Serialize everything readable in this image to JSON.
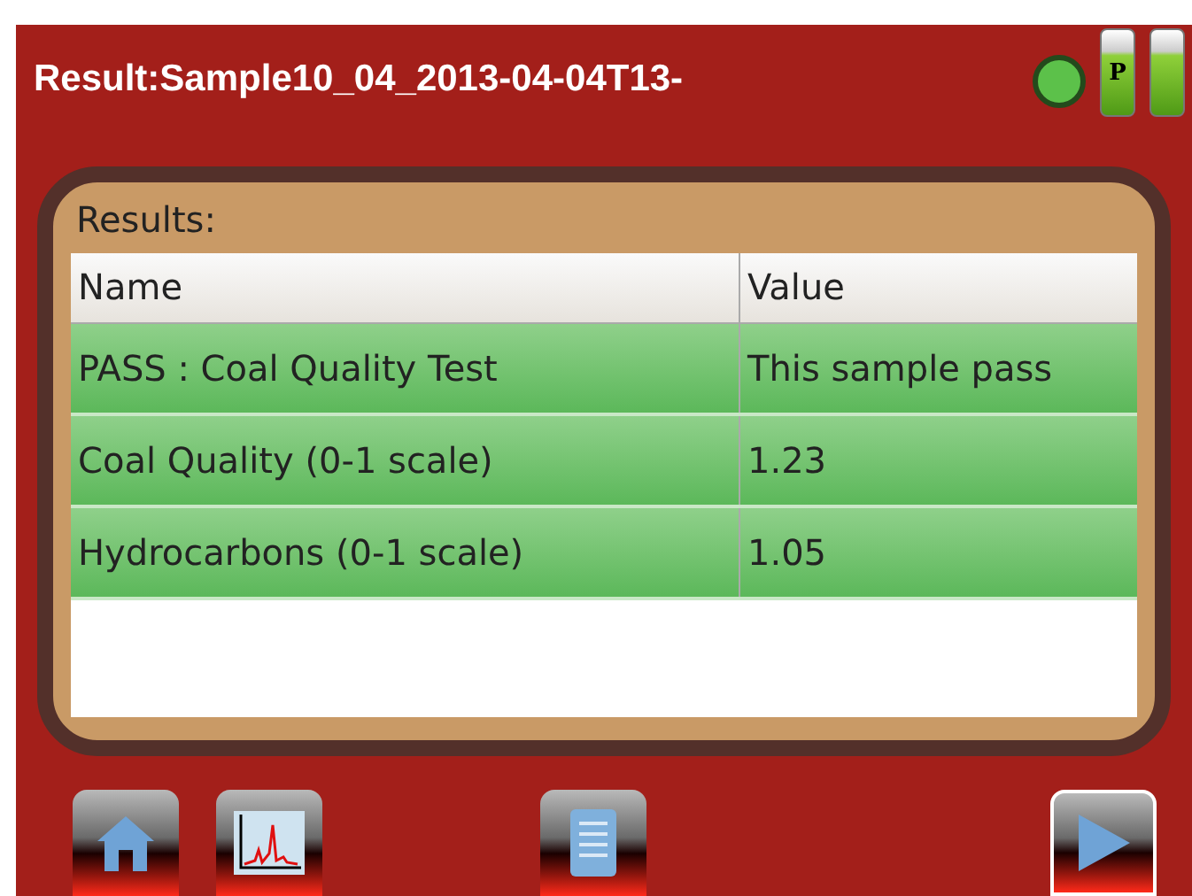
{
  "title": "Result:Sample10_04_2013-04-04T13-",
  "status": {
    "battery_label": "P"
  },
  "panel": {
    "label": "Results:"
  },
  "table": {
    "columns": [
      "Name",
      "Value"
    ],
    "rows": [
      {
        "cells": [
          "PASS : Coal Quality Test",
          "This sample pass"
        ]
      },
      {
        "cells": [
          "Coal Quality (0-1 scale)",
          "1.23"
        ]
      },
      {
        "cells": [
          "Hydrocarbons (0-1 scale)",
          "1.05"
        ]
      }
    ]
  },
  "toolbar": [
    {
      "kind": "home"
    },
    {
      "kind": "chart"
    },
    {
      "kind": "report"
    },
    {
      "kind": "next"
    }
  ]
}
